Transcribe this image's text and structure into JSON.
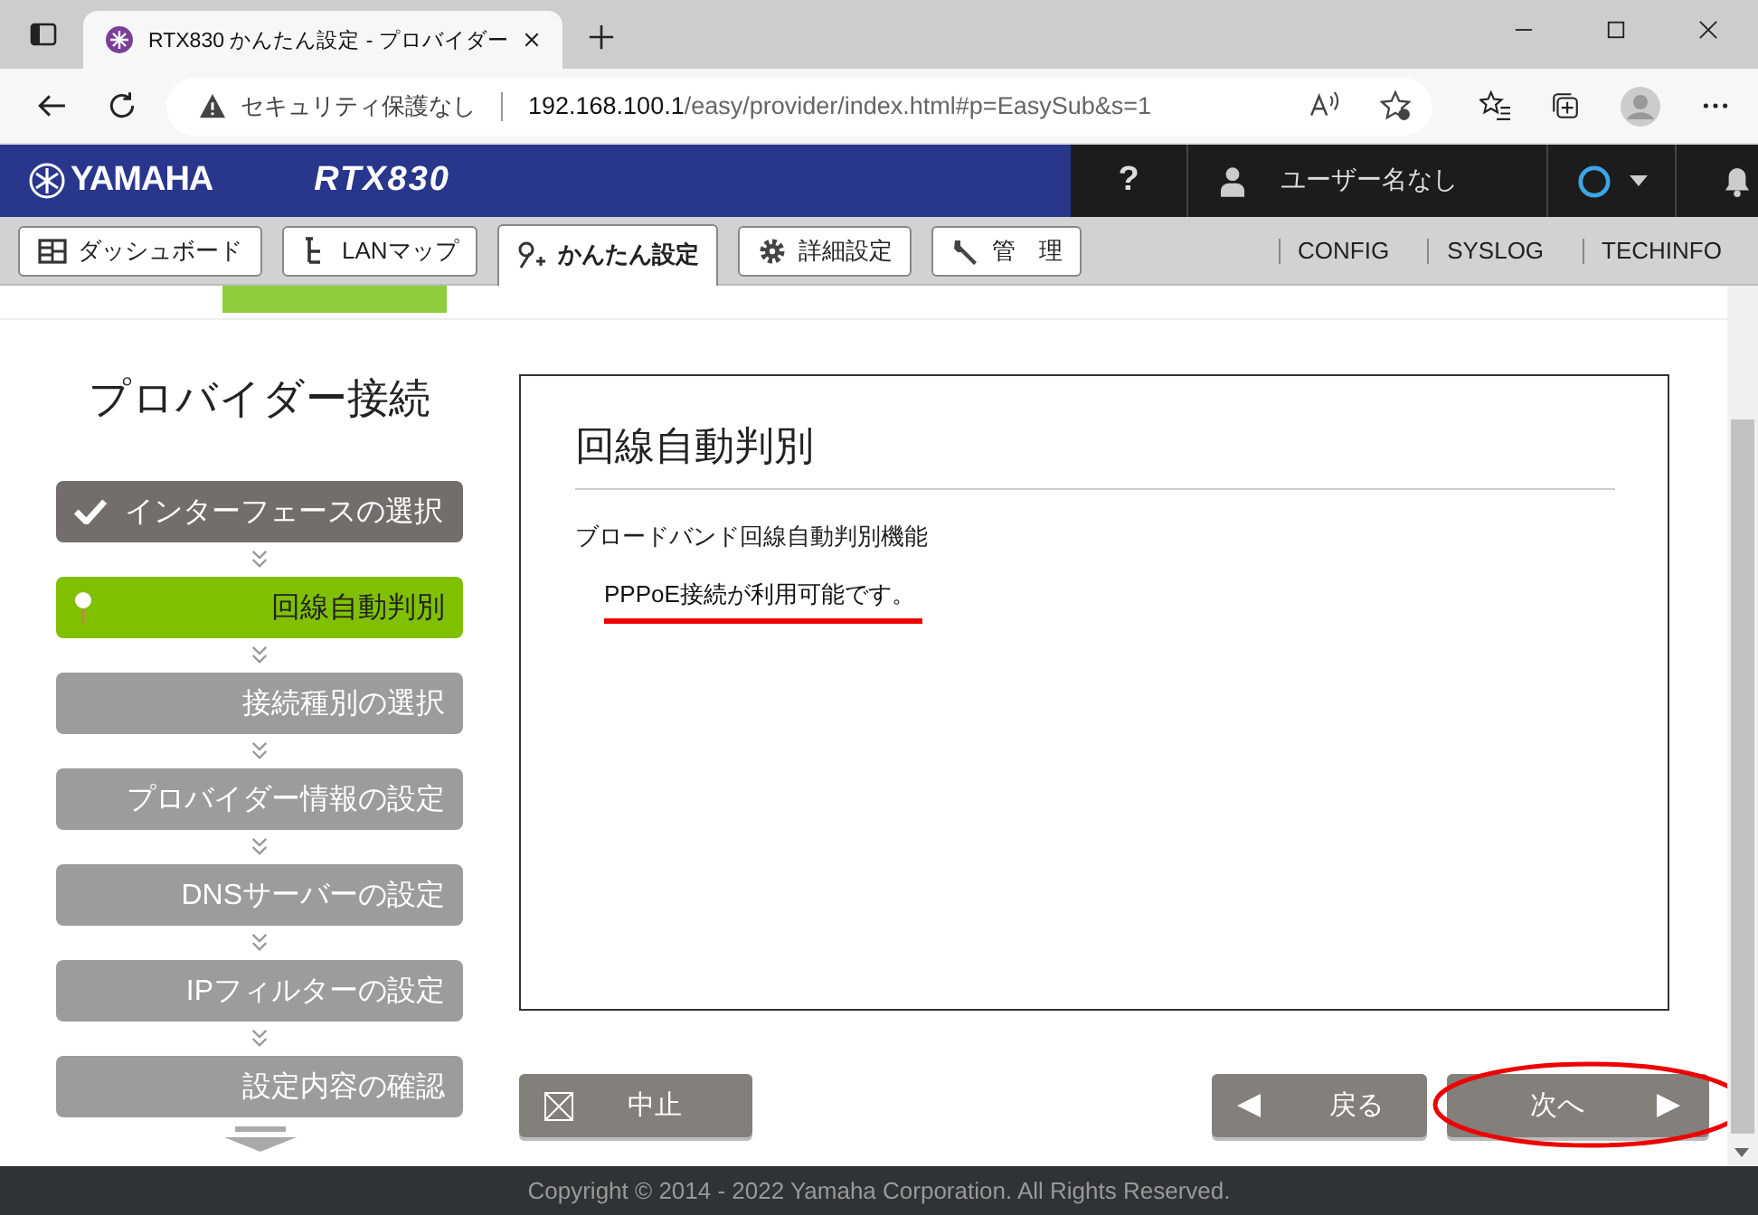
{
  "browser": {
    "tab_title": "RTX830 かんたん設定 - プロバイダー",
    "security": "セキュリティ保護なし",
    "url_host": "192.168.100.1",
    "url_path": "/easy/provider/index.html#p=EasySub&s=1"
  },
  "header": {
    "brand": "YAMAHA",
    "product": "RTX830",
    "help": "?",
    "user": "ユーザー名なし"
  },
  "nav": {
    "tabs": [
      {
        "label": "ダッシュボード",
        "selected": false
      },
      {
        "label": "LANマップ",
        "selected": false
      },
      {
        "label": "かんたん設定",
        "selected": true
      },
      {
        "label": "詳細設定",
        "selected": false
      },
      {
        "label": "管　理",
        "selected": false
      }
    ],
    "links": [
      "CONFIG",
      "SYSLOG",
      "TECHINFO"
    ]
  },
  "sidebar": {
    "title": "プロバイダー接続",
    "steps": [
      {
        "label": "インターフェースの選択",
        "kind": "done"
      },
      {
        "label": "回線自動判別",
        "kind": "current"
      },
      {
        "label": "接続種別の選択",
        "kind": "pending"
      },
      {
        "label": "プロバイダー情報の設定",
        "kind": "pending"
      },
      {
        "label": "DNSサーバーの設定",
        "kind": "pending"
      },
      {
        "label": "IPフィルターの設定",
        "kind": "pending"
      },
      {
        "label": "設定内容の確認",
        "kind": "pending"
      }
    ]
  },
  "panel": {
    "title": "回線自動判別",
    "label": "ブロードバンド回線自動判別機能",
    "result": "PPPoE接続が利用可能です。"
  },
  "buttons": {
    "cancel": "中止",
    "back": "戻る",
    "next": "次へ"
  },
  "footer": "Copyright © 2014 - 2022 Yamaha Corporation. All Rights Reserved."
}
